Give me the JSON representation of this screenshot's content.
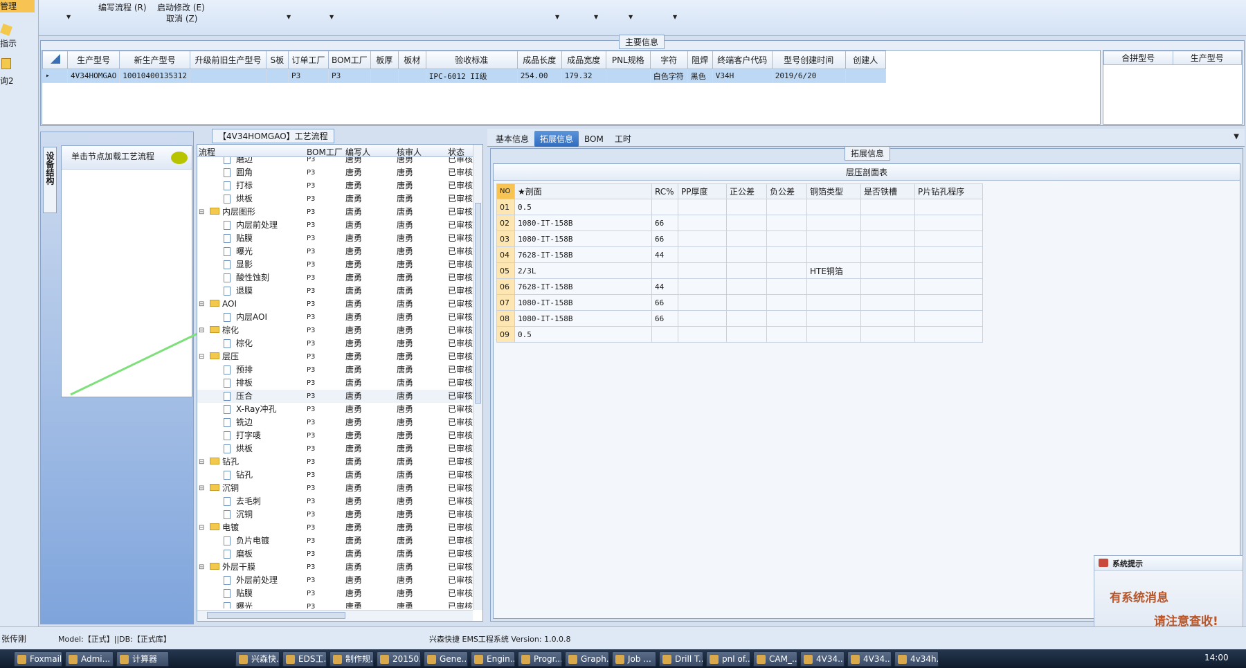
{
  "ribbon": {
    "items": [
      {
        "label": "编写流程 (R)"
      },
      {
        "label": "启动修改 (E)"
      },
      {
        "label": "取消 (Z)"
      }
    ]
  },
  "sidebar": {
    "top_label": "管理",
    "item1": "指示",
    "item2": "询2"
  },
  "main_info": {
    "title": "主要信息",
    "columns": [
      "生产型号",
      "新生产型号",
      "升级前旧生产型号",
      "S板",
      "订单工厂",
      "BOM工厂",
      "板厚",
      "板材",
      "验收标准",
      "成品长度",
      "成品宽度",
      "PNL规格",
      "字符",
      "阻焊",
      "终端客户代码",
      "型号创建时间",
      "创建人"
    ],
    "row": [
      "4V34HOMGAO",
      "10010400135312",
      "",
      "",
      "P3",
      "P3",
      "",
      "",
      "IPC-6012 II级",
      "254.00",
      "179.32",
      "",
      "白色字符",
      "黑色",
      "V34H",
      "2019/6/20",
      ""
    ],
    "side_columns": [
      "合拼型号",
      "生产型号"
    ]
  },
  "left_panel": {
    "vtab": "设备结构",
    "hint": "单击节点加载工艺流程"
  },
  "process": {
    "title": "【4V34HOMGAO】工艺流程",
    "columns": [
      "流程",
      "BOM工厂",
      "编写人",
      "核审人",
      "状态"
    ],
    "rows": [
      {
        "name": "磨边",
        "type": "doc",
        "level": 2,
        "bom": "P3",
        "writer": "唐勇",
        "reviewer": "唐勇",
        "status": "已审核"
      },
      {
        "name": "圆角",
        "type": "doc",
        "level": 2,
        "bom": "P3",
        "writer": "唐勇",
        "reviewer": "唐勇",
        "status": "已审核"
      },
      {
        "name": "打标",
        "type": "doc",
        "level": 2,
        "bom": "P3",
        "writer": "唐勇",
        "reviewer": "唐勇",
        "status": "已审核"
      },
      {
        "name": "烘板",
        "type": "doc",
        "level": 2,
        "bom": "P3",
        "writer": "唐勇",
        "reviewer": "唐勇",
        "status": "已审核"
      },
      {
        "name": "内层图形",
        "type": "folder",
        "level": 1,
        "bom": "P3",
        "writer": "唐勇",
        "reviewer": "唐勇",
        "status": "已审核"
      },
      {
        "name": "内层前处理",
        "type": "doc",
        "level": 2,
        "bom": "P3",
        "writer": "唐勇",
        "reviewer": "唐勇",
        "status": "已审核"
      },
      {
        "name": "贴膜",
        "type": "doc",
        "level": 2,
        "bom": "P3",
        "writer": "唐勇",
        "reviewer": "唐勇",
        "status": "已审核"
      },
      {
        "name": "曝光",
        "type": "doc",
        "level": 2,
        "bom": "P3",
        "writer": "唐勇",
        "reviewer": "唐勇",
        "status": "已审核"
      },
      {
        "name": "显影",
        "type": "doc",
        "level": 2,
        "bom": "P3",
        "writer": "唐勇",
        "reviewer": "唐勇",
        "status": "已审核"
      },
      {
        "name": "酸性蚀刻",
        "type": "doc",
        "level": 2,
        "bom": "P3",
        "writer": "唐勇",
        "reviewer": "唐勇",
        "status": "已审核"
      },
      {
        "name": "退膜",
        "type": "doc",
        "level": 2,
        "bom": "P3",
        "writer": "唐勇",
        "reviewer": "唐勇",
        "status": "已审核"
      },
      {
        "name": "AOI",
        "type": "folder",
        "level": 1,
        "bom": "P3",
        "writer": "唐勇",
        "reviewer": "唐勇",
        "status": "已审核"
      },
      {
        "name": "内层AOI",
        "type": "doc",
        "level": 2,
        "bom": "P3",
        "writer": "唐勇",
        "reviewer": "唐勇",
        "status": "已审核"
      },
      {
        "name": "棕化",
        "type": "folder",
        "level": 1,
        "bom": "P3",
        "writer": "唐勇",
        "reviewer": "唐勇",
        "status": "已审核"
      },
      {
        "name": "棕化",
        "type": "doc",
        "level": 2,
        "bom": "P3",
        "writer": "唐勇",
        "reviewer": "唐勇",
        "status": "已审核"
      },
      {
        "name": "层压",
        "type": "folder",
        "level": 1,
        "bom": "P3",
        "writer": "唐勇",
        "reviewer": "唐勇",
        "status": "已审核"
      },
      {
        "name": "预排",
        "type": "doc",
        "level": 2,
        "bom": "P3",
        "writer": "唐勇",
        "reviewer": "唐勇",
        "status": "已审核"
      },
      {
        "name": "排板",
        "type": "doc",
        "level": 2,
        "bom": "P3",
        "writer": "唐勇",
        "reviewer": "唐勇",
        "status": "已审核"
      },
      {
        "name": "压合",
        "type": "doc",
        "level": 2,
        "bom": "P3",
        "writer": "唐勇",
        "reviewer": "唐勇",
        "status": "已审核"
      },
      {
        "name": "X-Ray冲孔",
        "type": "doc",
        "level": 2,
        "bom": "P3",
        "writer": "唐勇",
        "reviewer": "唐勇",
        "status": "已审核"
      },
      {
        "name": "铣边",
        "type": "doc",
        "level": 2,
        "bom": "P3",
        "writer": "唐勇",
        "reviewer": "唐勇",
        "status": "已审核"
      },
      {
        "name": "打字唛",
        "type": "doc",
        "level": 2,
        "bom": "P3",
        "writer": "唐勇",
        "reviewer": "唐勇",
        "status": "已审核"
      },
      {
        "name": "烘板",
        "type": "doc",
        "level": 2,
        "bom": "P3",
        "writer": "唐勇",
        "reviewer": "唐勇",
        "status": "已审核"
      },
      {
        "name": "钻孔",
        "type": "folder",
        "level": 1,
        "bom": "P3",
        "writer": "唐勇",
        "reviewer": "唐勇",
        "status": "已审核"
      },
      {
        "name": "钻孔",
        "type": "doc",
        "level": 2,
        "bom": "P3",
        "writer": "唐勇",
        "reviewer": "唐勇",
        "status": "已审核"
      },
      {
        "name": "沉铜",
        "type": "folder",
        "level": 1,
        "bom": "P3",
        "writer": "唐勇",
        "reviewer": "唐勇",
        "status": "已审核"
      },
      {
        "name": "去毛刺",
        "type": "doc",
        "level": 2,
        "bom": "P3",
        "writer": "唐勇",
        "reviewer": "唐勇",
        "status": "已审核"
      },
      {
        "name": "沉铜",
        "type": "doc",
        "level": 2,
        "bom": "P3",
        "writer": "唐勇",
        "reviewer": "唐勇",
        "status": "已审核"
      },
      {
        "name": "电镀",
        "type": "folder",
        "level": 1,
        "bom": "P3",
        "writer": "唐勇",
        "reviewer": "唐勇",
        "status": "已审核"
      },
      {
        "name": "负片电镀",
        "type": "doc",
        "level": 2,
        "bom": "P3",
        "writer": "唐勇",
        "reviewer": "唐勇",
        "status": "已审核"
      },
      {
        "name": "磨板",
        "type": "doc",
        "level": 2,
        "bom": "P3",
        "writer": "唐勇",
        "reviewer": "唐勇",
        "status": "已审核"
      },
      {
        "name": "外层干膜",
        "type": "folder",
        "level": 1,
        "bom": "P3",
        "writer": "唐勇",
        "reviewer": "唐勇",
        "status": "已审核"
      },
      {
        "name": "外层前处理",
        "type": "doc",
        "level": 2,
        "bom": "P3",
        "writer": "唐勇",
        "reviewer": "唐勇",
        "status": "已审核"
      },
      {
        "name": "贴膜",
        "type": "doc",
        "level": 2,
        "bom": "P3",
        "writer": "唐勇",
        "reviewer": "唐勇",
        "status": "已审核"
      },
      {
        "name": "曝光",
        "type": "doc",
        "level": 2,
        "bom": "P3",
        "writer": "唐勇",
        "reviewer": "唐勇",
        "status": "已审核"
      }
    ]
  },
  "right_tabs": [
    "基本信息",
    "拓展信息",
    "BOM",
    "工时"
  ],
  "right_active_tab": 1,
  "ext_info": {
    "title": "拓展信息",
    "lam_title": "层压剖面表",
    "columns": [
      "NO",
      "★剖面",
      "RC%",
      "PP厚度",
      "正公差",
      "负公差",
      "铜箔类型",
      "是否铁槽",
      "P片钻孔程序"
    ],
    "rows": [
      [
        "01",
        "0.5",
        "",
        "",
        "",
        "",
        "",
        "",
        ""
      ],
      [
        "02",
        "1080-IT-158B",
        "66",
        "",
        "",
        "",
        "",
        "",
        ""
      ],
      [
        "03",
        "1080-IT-158B",
        "66",
        "",
        "",
        "",
        "",
        "",
        ""
      ],
      [
        "04",
        "7628-IT-158B",
        "44",
        "",
        "",
        "",
        "",
        "",
        ""
      ],
      [
        "05",
        "2/3L",
        "",
        "",
        "",
        "",
        "HTE铜箔",
        "",
        ""
      ],
      [
        "06",
        "7628-IT-158B",
        "44",
        "",
        "",
        "",
        "",
        "",
        ""
      ],
      [
        "07",
        "1080-IT-158B",
        "66",
        "",
        "",
        "",
        "",
        "",
        ""
      ],
      [
        "08",
        "1080-IT-158B",
        "66",
        "",
        "",
        "",
        "",
        "",
        ""
      ],
      [
        "09",
        "0.5",
        "",
        "",
        "",
        "",
        "",
        "",
        ""
      ]
    ]
  },
  "notification": {
    "title": "系统提示",
    "line1": "有系统消息",
    "line2": "请注意查收!"
  },
  "statusbar": {
    "user": "张传刚",
    "model": "Model:【正式】||DB:【正式库】",
    "app": "兴森快捷 EMS工程系统 Version: 1.0.0.8"
  },
  "taskbar": {
    "items": [
      "Foxmail",
      "Admi...",
      "计算器",
      "兴森快...",
      "EDS工...",
      "制作规...",
      "20150...",
      "Gene...",
      "Engin...",
      "Progr...",
      "Graph...",
      "Job ...",
      "Drill T...",
      "pnl of...",
      "CAM_...",
      "4V34...",
      "4V34...",
      "4v34h..."
    ],
    "clock": "14:00"
  },
  "colors": {
    "highlight_box": "#d63bd0",
    "annotation_line": "#7de07a",
    "selected_row": "#bcd8f4",
    "active_tab": "#2f6bbf"
  }
}
